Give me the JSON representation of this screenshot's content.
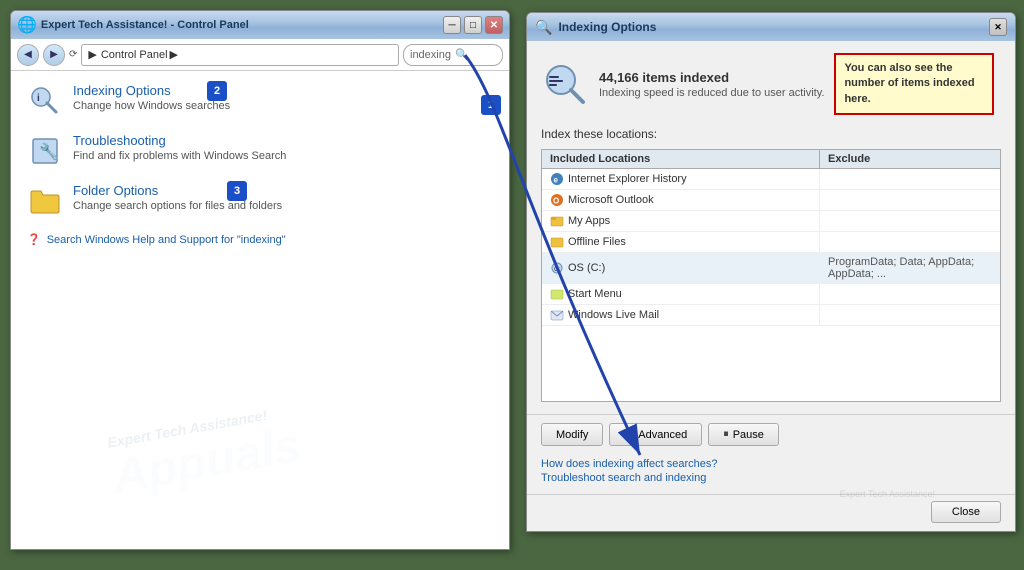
{
  "left_window": {
    "title": "Expert Tech Assistance! - Control Panel",
    "address": "Control Panel",
    "search_placeholder": "indexing",
    "items": [
      {
        "name": "indexing-options",
        "title": "Indexing Options",
        "subtitle": "Change how Windows searches",
        "annotation": "2"
      },
      {
        "name": "troubleshooting",
        "title": "Troubleshooting",
        "subtitle": "Find and fix problems with Windows Search",
        "annotation": null
      },
      {
        "name": "folder-options",
        "title": "Folder Options",
        "subtitle": "Change search options for files and folders",
        "annotation": "3"
      }
    ],
    "help_text": "Search Windows Help and Support for \"indexing\"",
    "annotation_1": "1"
  },
  "right_dialog": {
    "title": "Indexing Options",
    "items_indexed_count": "44,166 items indexed",
    "indexing_speed": "Indexing speed is reduced due to user activity.",
    "tooltip_text": "You can also see the number of items indexed here.",
    "index_locations_label": "Index these locations:",
    "columns": {
      "included": "Included Locations",
      "exclude": "Exclude"
    },
    "locations": [
      {
        "name": "Internet Explorer History",
        "exclude": ""
      },
      {
        "name": "Microsoft Outlook",
        "exclude": ""
      },
      {
        "name": "My Apps",
        "exclude": ""
      },
      {
        "name": "Offline Files",
        "exclude": ""
      },
      {
        "name": "OS (C:)",
        "exclude": "ProgramData; Data; AppData; AppData; ..."
      },
      {
        "name": "Start Menu",
        "exclude": ""
      },
      {
        "name": "Windows Live Mail",
        "exclude": ""
      }
    ],
    "buttons": {
      "modify": "Modify",
      "advanced": "Advanced",
      "pause": "Pause"
    },
    "links": {
      "how": "How does indexing affect searches?",
      "troubleshoot": "Troubleshoot search and indexing"
    },
    "close_label": "Close"
  }
}
